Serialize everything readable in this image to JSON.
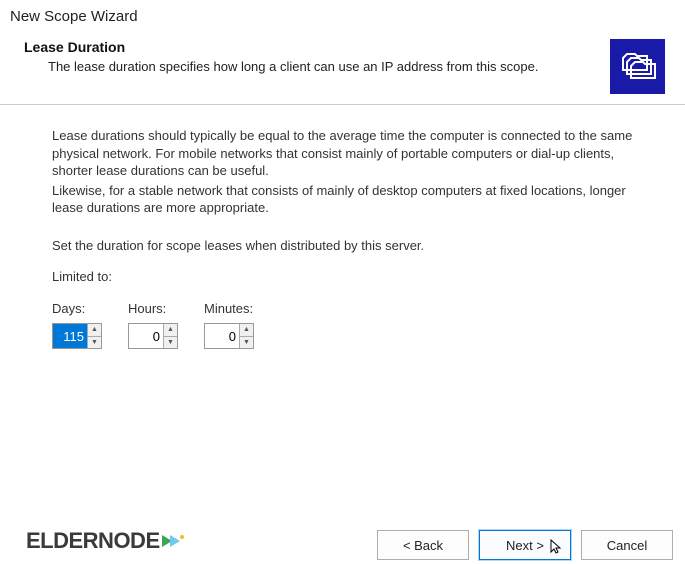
{
  "window_title": "New Scope Wizard",
  "header": {
    "title": "Lease Duration",
    "subtitle": "The lease duration specifies how long a client can use an IP address from this scope."
  },
  "content": {
    "para1": "Lease durations should typically be equal to the average time the computer is connected to the same physical network. For mobile networks that consist mainly of portable computers or dial-up clients, shorter lease durations can be useful.",
    "para2": "Likewise, for a stable network that consists of mainly of desktop computers at fixed locations, longer lease durations are more appropriate.",
    "para3": "Set the duration for scope leases when distributed by this server.",
    "limited": "Limited to:"
  },
  "fields": {
    "days": {
      "label": "Days:",
      "value": "115"
    },
    "hours": {
      "label": "Hours:",
      "value": "0"
    },
    "minutes": {
      "label": "Minutes:",
      "value": "0"
    }
  },
  "buttons": {
    "back": "< Back",
    "next": "Next >",
    "cancel": "Cancel"
  },
  "logo_text": "ELDERNODE"
}
